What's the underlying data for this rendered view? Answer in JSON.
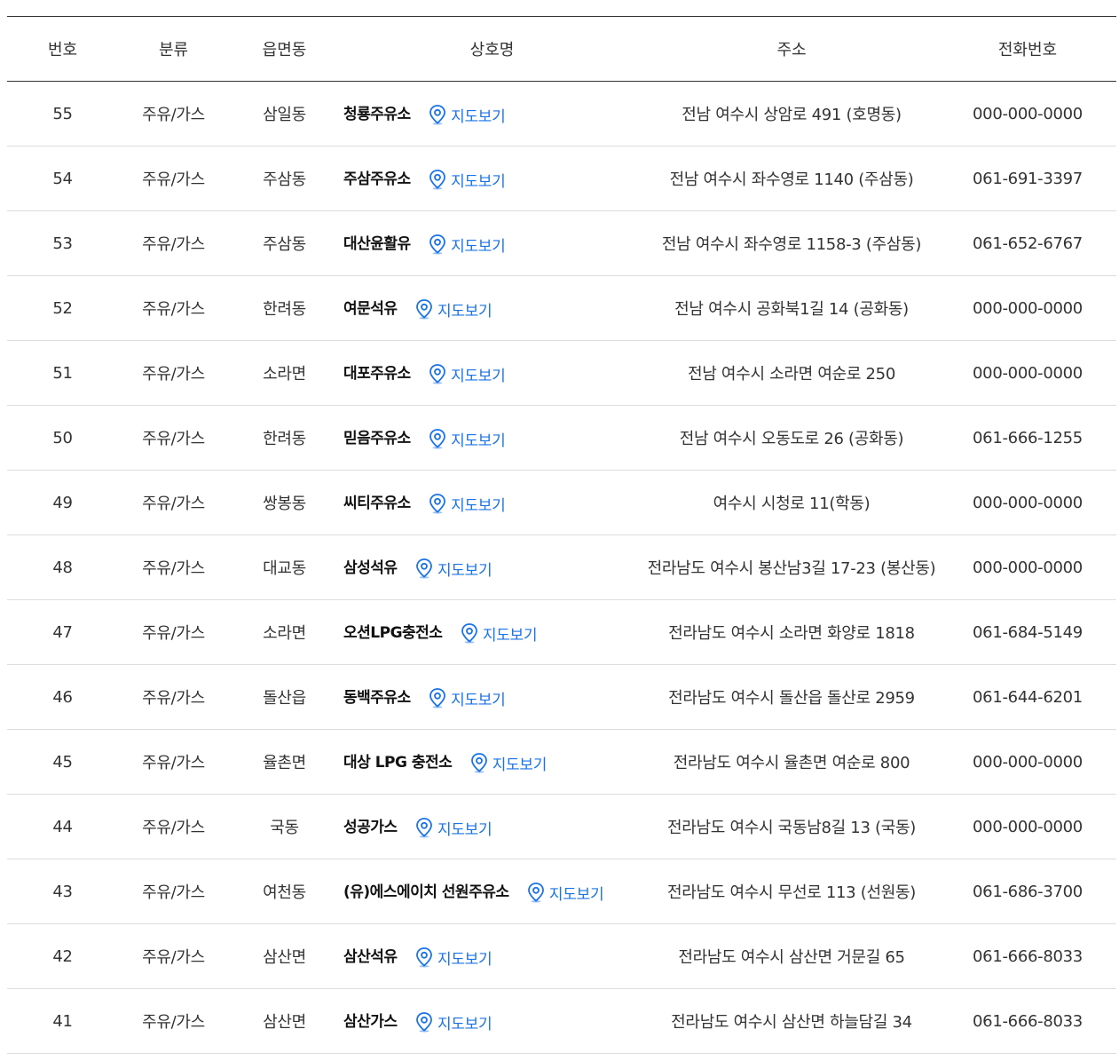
{
  "table": {
    "headers": {
      "no": "번호",
      "category": "분류",
      "district": "읍면동",
      "name": "상호명",
      "address": "주소",
      "phone": "전화번호"
    },
    "map_label": "지도보기",
    "map_icon": "map-pin-icon",
    "accent_color": "#1a73e8",
    "rows": [
      {
        "no": "55",
        "category": "주유/가스",
        "district": "삼일동",
        "name": "청룡주유소",
        "address": "전남 여수시 상암로 491 (호명동)",
        "phone": "000-000-0000"
      },
      {
        "no": "54",
        "category": "주유/가스",
        "district": "주삼동",
        "name": "주삼주유소",
        "address": "전남 여수시 좌수영로 1140 (주삼동)",
        "phone": "061-691-3397"
      },
      {
        "no": "53",
        "category": "주유/가스",
        "district": "주삼동",
        "name": "대산윤활유",
        "address": "전남 여수시 좌수영로 1158-3 (주삼동)",
        "phone": "061-652-6767"
      },
      {
        "no": "52",
        "category": "주유/가스",
        "district": "한려동",
        "name": "여문석유",
        "address": "전남 여수시 공화북1길 14 (공화동)",
        "phone": "000-000-0000"
      },
      {
        "no": "51",
        "category": "주유/가스",
        "district": "소라면",
        "name": "대포주유소",
        "address": "전남 여수시 소라면 여순로 250",
        "phone": "000-000-0000"
      },
      {
        "no": "50",
        "category": "주유/가스",
        "district": "한려동",
        "name": "믿음주유소",
        "address": "전남 여수시 오동도로 26 (공화동)",
        "phone": "061-666-1255"
      },
      {
        "no": "49",
        "category": "주유/가스",
        "district": "쌍봉동",
        "name": "씨티주유소",
        "address": "여수시 시청로 11(학동)",
        "phone": "000-000-0000"
      },
      {
        "no": "48",
        "category": "주유/가스",
        "district": "대교동",
        "name": "삼성석유",
        "address": "전라남도 여수시 봉산남3길 17-23 (봉산동)",
        "phone": "000-000-0000"
      },
      {
        "no": "47",
        "category": "주유/가스",
        "district": "소라면",
        "name": "오션LPG충전소",
        "address": "전라남도 여수시 소라면 화양로 1818",
        "phone": "061-684-5149"
      },
      {
        "no": "46",
        "category": "주유/가스",
        "district": "돌산읍",
        "name": "동백주유소",
        "address": "전라남도 여수시 돌산읍 돌산로 2959",
        "phone": "061-644-6201"
      },
      {
        "no": "45",
        "category": "주유/가스",
        "district": "율촌면",
        "name": "대상 LPG 충전소",
        "address": "전라남도 여수시 율촌면 여순로 800",
        "phone": "000-000-0000"
      },
      {
        "no": "44",
        "category": "주유/가스",
        "district": "국동",
        "name": "성공가스",
        "address": "전라남도 여수시 국동남8길 13 (국동)",
        "phone": "000-000-0000"
      },
      {
        "no": "43",
        "category": "주유/가스",
        "district": "여천동",
        "name": "(유)에스에이치 선원주유소",
        "address": "전라남도 여수시 무선로 113 (선원동)",
        "phone": "061-686-3700"
      },
      {
        "no": "42",
        "category": "주유/가스",
        "district": "삼산면",
        "name": "삼산석유",
        "address": "전라남도 여수시 삼산면 거문길 65",
        "phone": "061-666-8033"
      },
      {
        "no": "41",
        "category": "주유/가스",
        "district": "삼산면",
        "name": "삼산가스",
        "address": "전라남도 여수시 삼산면 하늘담길 34",
        "phone": "061-666-8033"
      }
    ]
  }
}
